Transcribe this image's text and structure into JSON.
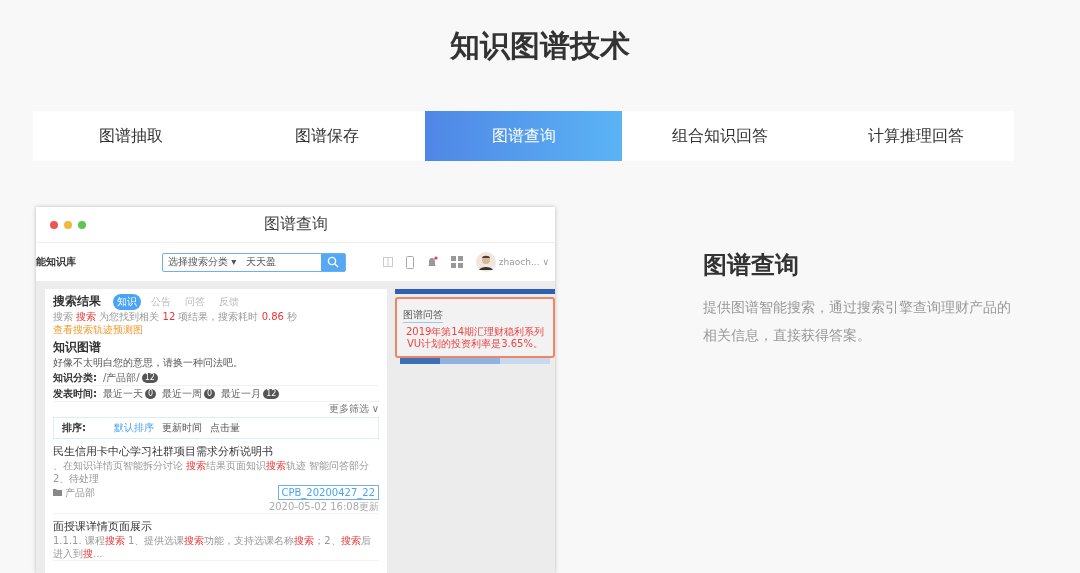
{
  "title": "知识图谱技术",
  "tabs": [
    {
      "label": "图谱抽取",
      "selected": false
    },
    {
      "label": "图谱保存",
      "selected": false
    },
    {
      "label": "图谱查询",
      "selected": true
    },
    {
      "label": "组合知识回答",
      "selected": false
    },
    {
      "label": "计算推理回答",
      "selected": false
    }
  ],
  "preview": {
    "window_title": "图谱查询",
    "logo": "能知识库",
    "search_category": "选择搜索分类",
    "search_caret": "▾",
    "user_caret": "∨",
    "search_value": "天天盈",
    "user": "zhaoch...",
    "results_title": "搜索结果",
    "result_tabs": [
      {
        "label": "知识",
        "selected": true
      },
      {
        "label": "公告",
        "selected": false
      },
      {
        "label": "问答",
        "selected": false
      },
      {
        "label": "反馈",
        "selected": false
      }
    ],
    "stats": [
      {
        "text": "搜索 ",
        "highlight": false
      },
      {
        "text": "搜索",
        "highlight": true
      },
      {
        "text": " 为您找到相关 ",
        "highlight": false
      },
      {
        "text": "12",
        "highlight": true
      },
      {
        "text": " 项结果，搜索耗时 ",
        "highlight": false
      },
      {
        "text": "0.86",
        "highlight": true
      },
      {
        "text": " 秒",
        "highlight": false
      }
    ],
    "trace_link": "查看搜索轨迹预测图",
    "graph_title": "知识图谱",
    "graph_message": "好像不太明白您的意思，请换一种问法吧。",
    "filters": [
      {
        "label": "知识分类:",
        "options": [
          {
            "text": "/产品部/",
            "count": "12"
          }
        ]
      },
      {
        "label": "发表时间:",
        "options": [
          {
            "text": "最近一天",
            "count": "0"
          },
          {
            "text": "最近一周",
            "count": "0"
          },
          {
            "text": "最近一月",
            "count": "12"
          }
        ]
      }
    ],
    "more_filters": "更多筛选 ∨",
    "sort_label": "排序:",
    "sort_options": [
      {
        "label": "默认排序",
        "selected": true
      },
      {
        "label": "更新时间",
        "selected": false
      },
      {
        "label": "点击量",
        "selected": false
      }
    ],
    "results": [
      {
        "title": "民生信用卡中心学习社群项目需求分析说明书",
        "snippet": [
          {
            "text": "、在知识详情页智能拆分讨论 ",
            "highlight": false
          },
          {
            "text": "搜索",
            "highlight": true
          },
          {
            "text": "结果页面知识",
            "highlight": false
          },
          {
            "text": "搜索",
            "highlight": true
          },
          {
            "text": "轨迹 智能问答部分 2、待处理",
            "highlight": false
          }
        ],
        "folder": "产品部",
        "tag": "CPB_20200427_22",
        "date": "2020-05-02 16:08更新"
      },
      {
        "title": "面授课详情页面展示",
        "snippet": [
          {
            "text": "1.1.1. 课程",
            "highlight": false
          },
          {
            "text": "搜索",
            "highlight": true
          },
          {
            "text": " 1、提供选课",
            "highlight": false
          },
          {
            "text": "搜索",
            "highlight": true
          },
          {
            "text": "功能，支持选课名称",
            "highlight": false
          },
          {
            "text": "搜索",
            "highlight": true
          },
          {
            "text": "；2、",
            "highlight": false
          },
          {
            "text": "搜索",
            "highlight": true
          },
          {
            "text": "后进入到",
            "highlight": false
          },
          {
            "text": "搜",
            "highlight": true
          },
          {
            "text": "...",
            "highlight": false
          }
        ]
      }
    ],
    "answer_title": "图谱问答",
    "answer_text": "2019年第14期汇理财稳利系列VU计划的投资利率是3.65%。"
  },
  "feature": {
    "title": "图谱查询",
    "description": "提供图谱智能搜索，通过搜索引擎查询理财产品的相关信息，直接获得答案。"
  }
}
